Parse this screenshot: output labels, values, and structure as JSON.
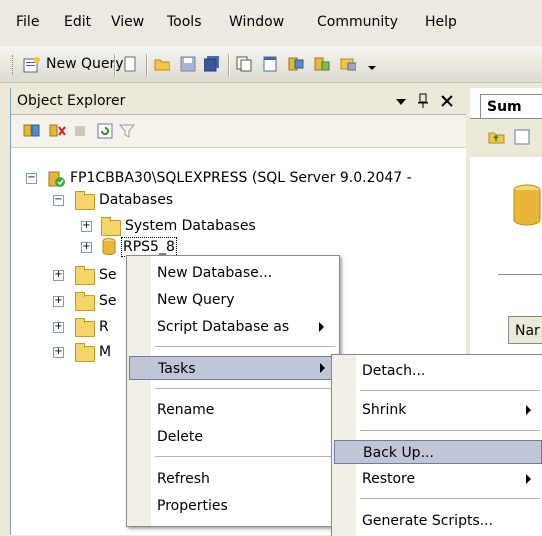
{
  "menubar": {
    "items": [
      "File",
      "Edit",
      "View",
      "Tools",
      "Window",
      "Community",
      "Help"
    ]
  },
  "toolbar": {
    "new_query_label": "New Query",
    "icons": [
      "new-query-icon",
      "new-file-icon",
      "open-folder-icon",
      "save-icon",
      "save-all-icon",
      "copy-icon",
      "notepad-icon",
      "registered-servers-icon",
      "object-explorer-icon",
      "template-explorer-icon"
    ]
  },
  "object_explorer": {
    "title": "Object Explorer",
    "pin_glyph": "↓ Ȅ ✕",
    "server_node": "FP1CBBA30\\SQLEXPRESS (SQL Server 9.0.2047 -",
    "databases_node": "Databases",
    "system_databases_node": "System Databases",
    "selected_db": "RPS5_8",
    "other_nodes": [
      "Se",
      "Se",
      "R",
      "M"
    ]
  },
  "right_panel": {
    "tab_label": "Sum",
    "column_label": "Nar"
  },
  "context_menu": {
    "items": [
      "New Database...",
      "New Query",
      "Script Database as",
      "Tasks",
      "Rename",
      "Delete",
      "Refresh",
      "Properties"
    ]
  },
  "tasks_submenu": {
    "items": [
      "Detach...",
      "Shrink",
      "Back Up...",
      "Restore",
      "Generate Scripts..."
    ]
  },
  "colors": {
    "highlight": "#c1c6d6",
    "folder": "#f5d46a",
    "menu_bg": "#ece9d8"
  }
}
